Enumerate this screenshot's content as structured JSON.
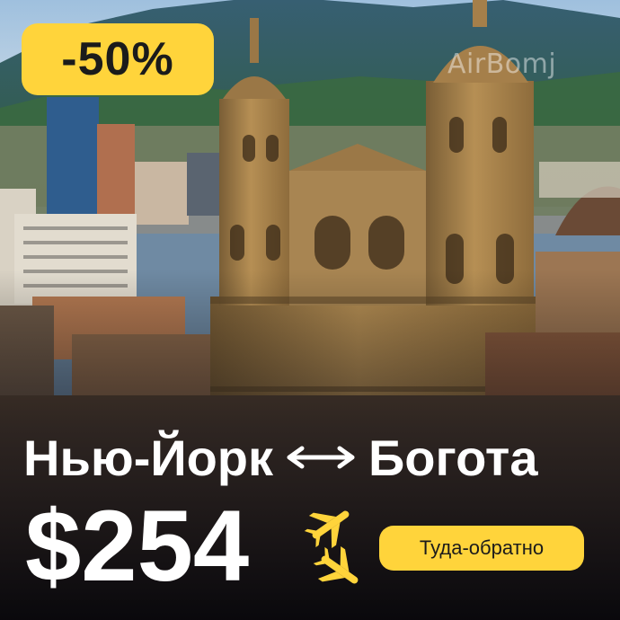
{
  "promo": {
    "discount": "-50%",
    "origin": "Нью-Йорк",
    "destination": "Богота",
    "price": "$254",
    "trip_type": "Туда-обратно",
    "watermark": "AirBomj"
  },
  "colors": {
    "accent": "#FFD43B",
    "text": "#FFFFFF",
    "dark": "#1B1B1B"
  },
  "icons": [
    "double-arrow-icon",
    "airplane-icon"
  ]
}
